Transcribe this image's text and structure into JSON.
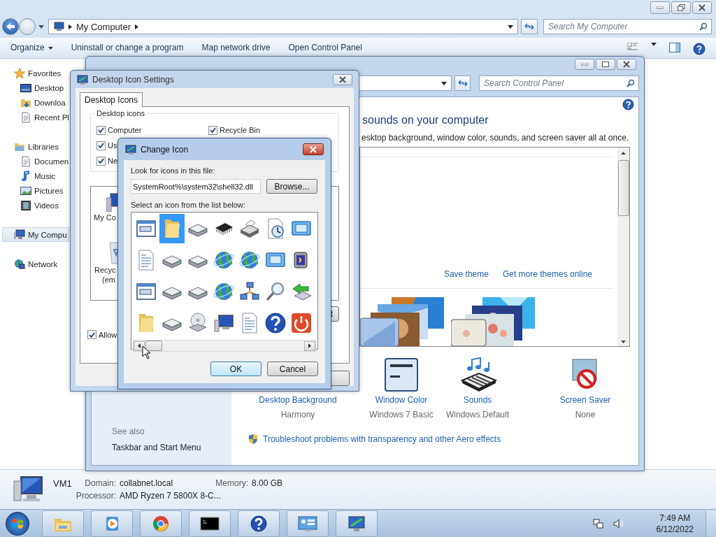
{
  "explorer": {
    "address": "My Computer",
    "search": {
      "placeholder": "Search My Computer"
    },
    "toolbar": [
      "Organize",
      "Uninstall or change a program",
      "Map network drive",
      "Open Control Panel"
    ],
    "nav": [
      {
        "label": "Favorites",
        "selected": false,
        "children": [
          {
            "label": "Desktop",
            "selected": false
          },
          {
            "label": "Downloa",
            "selected": false
          },
          {
            "label": "Recent Pl",
            "selected": false
          }
        ]
      },
      {
        "label": "Libraries",
        "selected": false,
        "children": [
          {
            "label": "Documen",
            "selected": false
          },
          {
            "label": "Music",
            "selected": false
          },
          {
            "label": "Pictures",
            "selected": false
          },
          {
            "label": "Videos",
            "selected": false
          }
        ]
      },
      {
        "label": "My Compu",
        "selected": true
      },
      {
        "label": "Network",
        "selected": false
      }
    ],
    "details": {
      "name": "VM1",
      "fields": [
        {
          "label": "Domain:",
          "value": "collabnet.local"
        },
        {
          "label": "Memory:",
          "value": "8.00 GB"
        },
        {
          "label": "Processor:",
          "value": "AMD Ryzen 7 5800X 8-C..."
        }
      ]
    }
  },
  "control_panel": {
    "search": {
      "placeholder": "Search Control Panel"
    },
    "heading": "sounds on your computer",
    "description": "esktop background, window color, sounds, and screen saver all at once.",
    "theme_links": [
      "Save theme",
      "Get more themes online"
    ],
    "settings": [
      {
        "label": "Desktop Background",
        "value": "Harmony"
      },
      {
        "label": "Window Color",
        "value": "Windows 7 Basic"
      },
      {
        "label": "Sounds",
        "value": "Windows Default"
      },
      {
        "label": "Screen Saver",
        "value": "None"
      }
    ],
    "troubleshoot": "Troubleshoot problems with transparency and other Aero effects",
    "see_also": {
      "heading": "See also",
      "links": [
        "Taskbar and Start Menu"
      ]
    }
  },
  "desktop_icon_settings": {
    "title": "Desktop Icon Settings",
    "tabs": [
      {
        "label": "Desktop Icons",
        "selected": true
      }
    ],
    "group": "Desktop icons",
    "checkboxes": [
      {
        "label": "Computer",
        "checked": true
      },
      {
        "label": "Recycle Bin",
        "checked": true
      },
      {
        "label": "Us",
        "checked": true
      },
      {
        "label": "Ne",
        "checked": true
      }
    ],
    "icon_labels": [
      "My Co",
      "Recyc",
      "(em"
    ],
    "allow": {
      "label": "Allow",
      "checked": true
    },
    "button": "t"
  },
  "change_icon": {
    "title": "Change Icon",
    "file_label": "Look for icons in this file:",
    "file_value": "SystemRoot%\\system32\\shell32.dll",
    "browse": "Browse...",
    "list_label": "Select an icon from the list below:",
    "icons": [
      {
        "selected": false
      },
      {
        "selected": true
      },
      {
        "selected": false
      },
      {
        "selected": false
      },
      {
        "selected": false
      },
      {
        "selected": false
      },
      {
        "selected": false
      },
      {
        "selected": false
      },
      {
        "selected": false
      },
      {
        "selected": false
      },
      {
        "selected": false
      },
      {
        "selected": false
      },
      {
        "selected": false
      },
      {
        "selected": false
      },
      {
        "selected": false
      },
      {
        "selected": false
      },
      {
        "selected": false
      },
      {
        "selected": false
      },
      {
        "selected": false
      },
      {
        "selected": false
      },
      {
        "selected": false
      },
      {
        "selected": false
      },
      {
        "selected": false
      },
      {
        "selected": false
      },
      {
        "selected": false
      },
      {
        "selected": false
      },
      {
        "selected": false
      },
      {
        "selected": false
      }
    ],
    "buttons": [
      "OK",
      "Cancel"
    ]
  },
  "taskbar": {
    "time": "7:49 AM",
    "date": "6/12/2022"
  }
}
